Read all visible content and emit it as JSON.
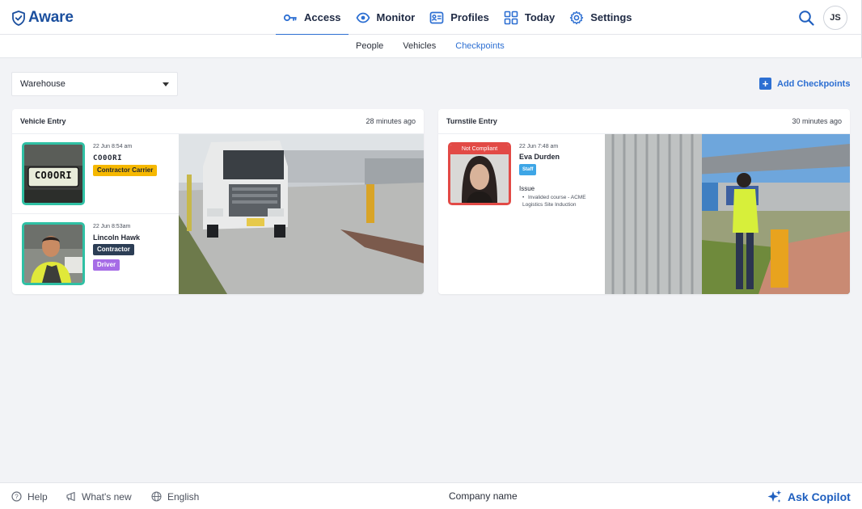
{
  "app": {
    "name": "Aware",
    "brand_color": "#1b4f9e",
    "accent": "#2d6fd2"
  },
  "nav": {
    "items": [
      {
        "label": "Access",
        "icon": "key-icon",
        "active": true
      },
      {
        "label": "Monitor",
        "icon": "eye-icon"
      },
      {
        "label": "Profiles",
        "icon": "profile-card-icon"
      },
      {
        "label": "Today",
        "icon": "grid-icon"
      },
      {
        "label": "Settings",
        "icon": "gear-icon"
      }
    ],
    "user_initials": "JS"
  },
  "subnav": {
    "items": [
      {
        "label": "People"
      },
      {
        "label": "Vehicles"
      },
      {
        "label": "Checkpoints",
        "active": true
      }
    ]
  },
  "toolbar": {
    "location": "Warehouse",
    "add_label": "Add Checkpoints"
  },
  "checkpoints": [
    {
      "title": "Vehicle Entry",
      "time": "28 minutes ago",
      "entries": [
        {
          "date": "22 Jun 8:54 am",
          "plate": "CO0ORI",
          "badges": [
            "Contractor Carrier"
          ],
          "thumb_plate": "CO0ORI"
        },
        {
          "date": "22 Jun 8:53am",
          "name": "Lincoln Hawk",
          "badges": [
            "Contractor",
            "Driver"
          ]
        }
      ]
    },
    {
      "title": "Turnstile Entry",
      "time": "30 minutes ago",
      "entries": [
        {
          "status": "Not Compliant",
          "date": "22 Jun 7:48 am",
          "name": "Eva Durden",
          "badges": [
            "Staff"
          ],
          "issue_title": "Issue",
          "issues": [
            "Invalided course - ACME Logistics Site Induction"
          ]
        }
      ]
    }
  ],
  "footer": {
    "help": "Help",
    "whats_new": "What's new",
    "language": "English",
    "company": "Company name",
    "copilot": "Ask Copilot"
  },
  "colors": {
    "compliant": "#2fc0a4",
    "non_compliant": "#e24a46"
  }
}
